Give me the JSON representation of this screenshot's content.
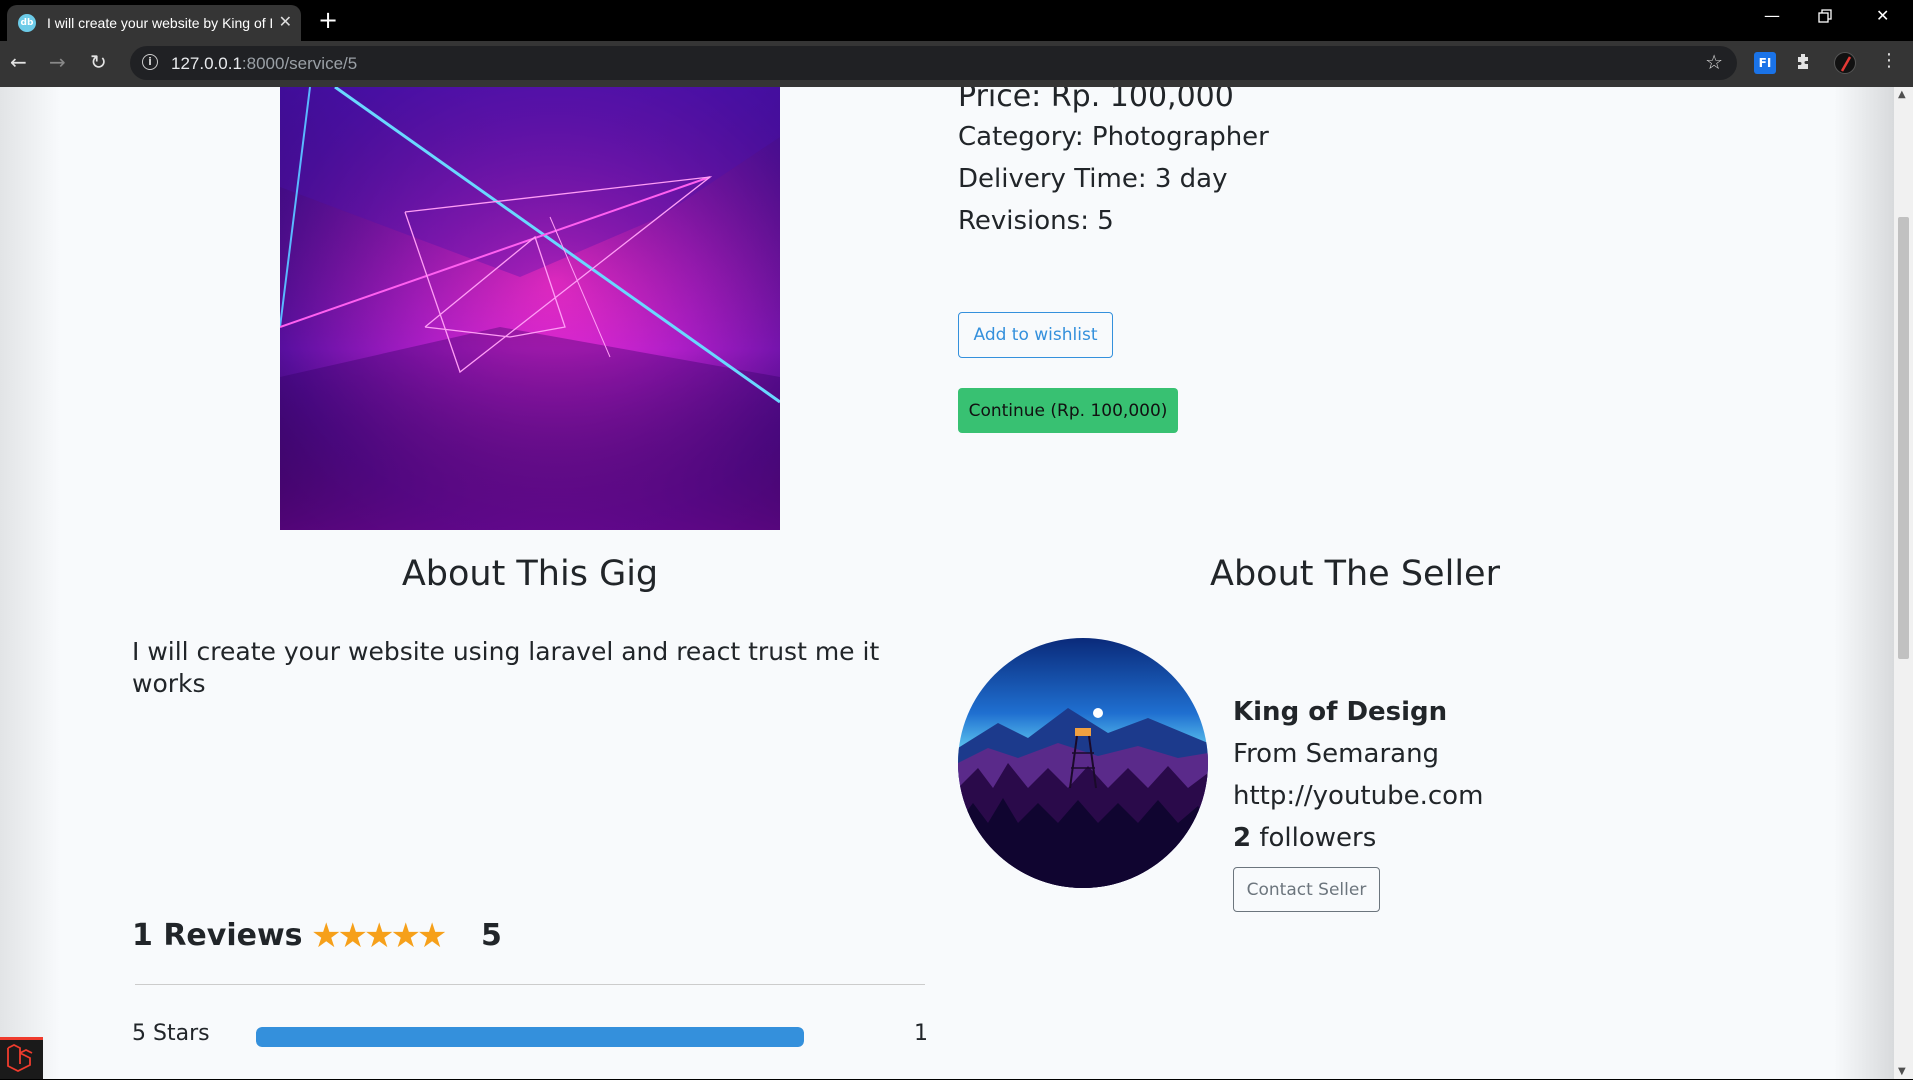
{
  "browser": {
    "tab_title": "I will create your website by King of Design",
    "favicon_text": "db",
    "url_host": "127.0.0.1",
    "url_rest": ":8000/service/5",
    "close_glyph": "✕",
    "new_tab_glyph": "+"
  },
  "service": {
    "price": "Price: Rp. 100,000",
    "category": "Category: Photographer",
    "delivery": "Delivery Time: 3 day",
    "revisions": "Revisions: 5",
    "wishlist_label": "Add to wishlist",
    "continue_label": "Continue (Rp. 100,000)"
  },
  "about_gig": {
    "title": "About This Gig",
    "description": "I will create your website using laravel and react trust me it works"
  },
  "seller": {
    "section_title": "About The Seller",
    "name": "King of Design",
    "location": "From Semarang",
    "website": "http://youtube.com",
    "followers_count": "2",
    "followers_label": "followers",
    "contact_label": "Contact Seller"
  },
  "reviews": {
    "heading": "1 Reviews",
    "stars": "★★★★★",
    "rating": "5",
    "rating_value": 5,
    "breakdown": [
      {
        "label": "5 Stars",
        "count": "1",
        "fraction": 1.0
      }
    ]
  },
  "colors": {
    "primary": "#3490dc",
    "success": "#38c172",
    "star": "#f6a01a",
    "page_bg": "#f8fafc"
  }
}
